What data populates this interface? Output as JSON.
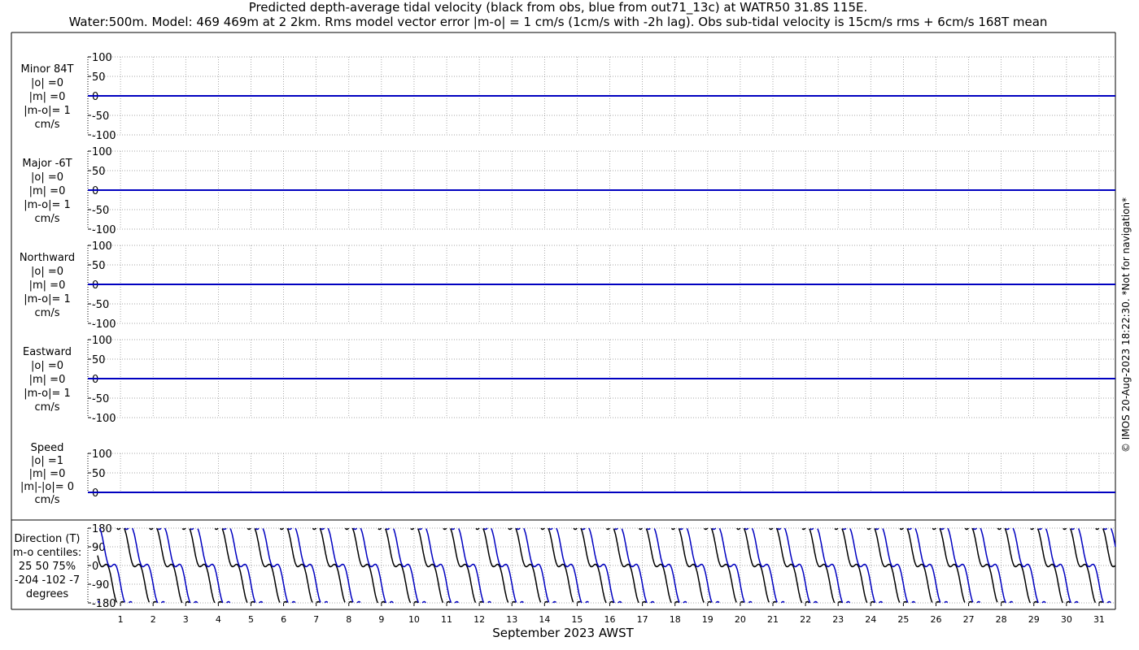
{
  "figure": {
    "title_line1": "Predicted depth-average tidal velocity (black from obs, blue from out71_13c) at WATR50 31.8S 115E.",
    "title_line2": "Water:500m. Model: 469 469m at 2 2km. Rms model vector error |m-o| = 1 cm/s (1cm/s with -2h lag). Obs sub-tidal velocity is 15cm/s rms + 6cm/s 168T mean",
    "copyright": "© IMOS 20-Aug-2023 18:22:30. *Not for navigation*",
    "xlabel": "September 2023 AWST",
    "colors": {
      "obs": "#000000",
      "model": "#0000c0",
      "grid": "#888888"
    }
  },
  "chart_data": [
    {
      "type": "line",
      "panel": "minor",
      "labels": [
        "Minor 84T",
        "|o| =0",
        "|m| =0",
        "|m-o|= 1",
        "cm/s"
      ],
      "ylim": [
        -100,
        100
      ],
      "yticks": [
        100,
        50,
        0,
        -50,
        -100
      ],
      "ytick_labels": [
        "100",
        "50",
        "0",
        "-50",
        "-100"
      ],
      "series": [
        {
          "role": "obs",
          "constant": 0
        },
        {
          "role": "model",
          "constant": 0
        }
      ]
    },
    {
      "type": "line",
      "panel": "major",
      "labels": [
        "Major -6T",
        "|o| =0",
        "|m| =0",
        "|m-o|= 1",
        "cm/s"
      ],
      "ylim": [
        -100,
        100
      ],
      "yticks": [
        100,
        50,
        0,
        -50,
        -100
      ],
      "ytick_labels": [
        "100",
        "50",
        "0",
        "-50",
        "-100"
      ],
      "series": [
        {
          "role": "obs",
          "constant": 0
        },
        {
          "role": "model",
          "constant": 0
        }
      ]
    },
    {
      "type": "line",
      "panel": "northward",
      "labels": [
        "Northward",
        "|o| =0",
        "|m| =0",
        "|m-o|= 1",
        "cm/s"
      ],
      "ylim": [
        -100,
        100
      ],
      "yticks": [
        100,
        50,
        0,
        -50,
        -100
      ],
      "ytick_labels": [
        "100",
        "50",
        "0",
        "-50",
        "-100"
      ],
      "series": [
        {
          "role": "obs",
          "constant": 0
        },
        {
          "role": "model",
          "constant": 0
        }
      ]
    },
    {
      "type": "line",
      "panel": "eastward",
      "labels": [
        "Eastward",
        "|o| =0",
        "|m| =0",
        "|m-o|= 1",
        "cm/s"
      ],
      "ylim": [
        -100,
        100
      ],
      "yticks": [
        100,
        50,
        0,
        -50,
        -100
      ],
      "ytick_labels": [
        "100",
        "50",
        "0",
        "-50",
        "-100"
      ],
      "series": [
        {
          "role": "obs",
          "constant": 0
        },
        {
          "role": "model",
          "constant": 0
        }
      ]
    },
    {
      "type": "line",
      "panel": "speed",
      "labels": [
        "Speed",
        "|o| =1",
        "|m| =0",
        "|m|-|o|= 0",
        "cm/s"
      ],
      "ylim": [
        0,
        100
      ],
      "yticks": [
        100,
        50,
        0
      ],
      "ytick_labels": [
        "100",
        "50",
        "0"
      ],
      "series": [
        {
          "role": "obs",
          "constant": 0
        },
        {
          "role": "model",
          "constant": 0
        }
      ]
    },
    {
      "type": "line",
      "panel": "direction",
      "labels": [
        "Direction (T)",
        "m-o centiles:",
        "25  50  75%",
        "-204 -102   -7",
        "degrees"
      ],
      "ylim": [
        -180,
        180
      ],
      "yticks": [
        180,
        90,
        0,
        -90,
        -180
      ],
      "ytick_labels": [
        "180",
        "90",
        "0",
        "-90",
        "-180"
      ],
      "x_days": [
        1,
        32
      ],
      "period_days": 1.0,
      "series": [
        {
          "role": "obs",
          "phase_days": 0.0
        },
        {
          "role": "model",
          "phase_days": 0.25
        }
      ]
    }
  ],
  "x_axis": {
    "range_days": [
      0,
      31.5
    ],
    "tick_labels": [
      "1",
      "2",
      "3",
      "4",
      "5",
      "6",
      "7",
      "8",
      "9",
      "10",
      "11",
      "12",
      "13",
      "14",
      "15",
      "16",
      "17",
      "18",
      "19",
      "20",
      "21",
      "22",
      "23",
      "24",
      "25",
      "26",
      "27",
      "28",
      "29",
      "30",
      "31"
    ]
  }
}
